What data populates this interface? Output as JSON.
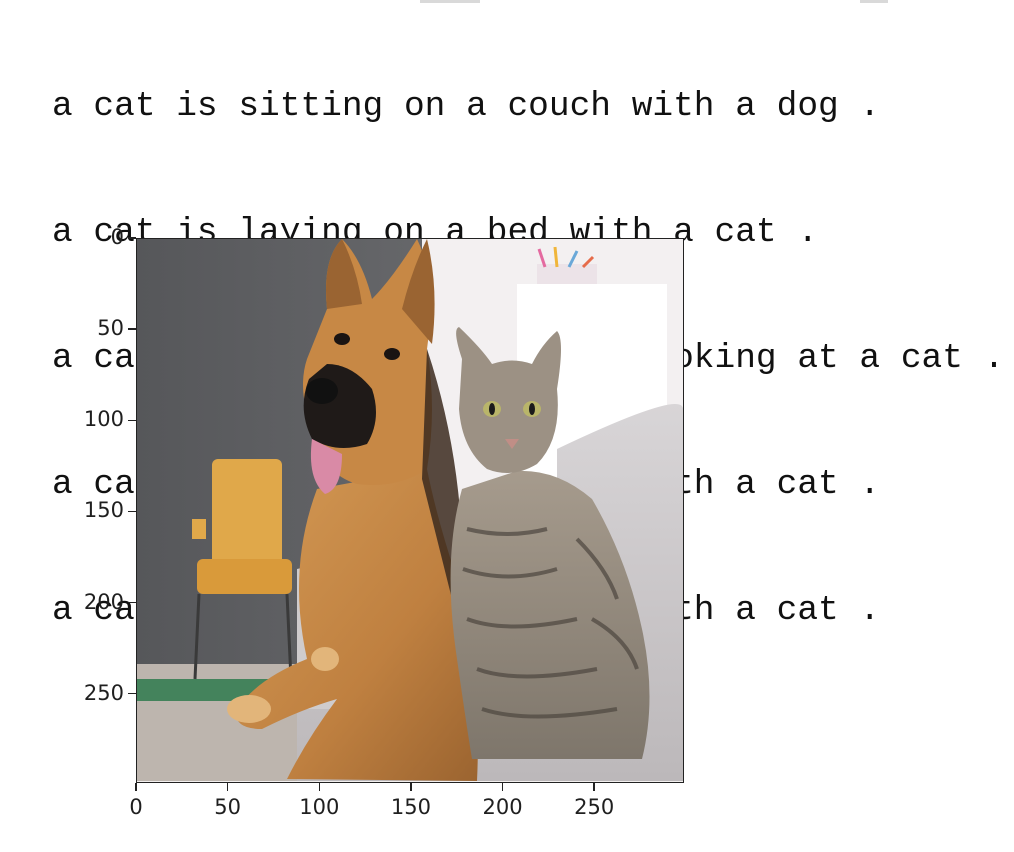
{
  "captions": [
    "a cat is sitting on a couch with a dog .",
    "a cat is laying on a bed with a cat .",
    "a cat is sitting on a couch looking at a cat .",
    "a cat is sitting in a chair with a cat .",
    "a cat is sitting in a chair with a cat ."
  ],
  "image_plot": {
    "x_axis": {
      "range": [
        0,
        299
      ],
      "tick_labels": [
        "0",
        "50",
        "100",
        "150",
        "200",
        "250"
      ]
    },
    "y_axis": {
      "range": [
        0,
        299
      ],
      "tick_labels": [
        "0",
        "50",
        "100",
        "150",
        "200",
        "250"
      ]
    },
    "image_content": "dog-and-cat-on-couch"
  },
  "colors": {
    "axis": "#222222",
    "text": "#111111",
    "wall": "#595a5c",
    "chair": "#e0a84a",
    "couch": "#c9c6c7",
    "dog_coat": "#c78845",
    "cat_coat": "#8c8378"
  }
}
